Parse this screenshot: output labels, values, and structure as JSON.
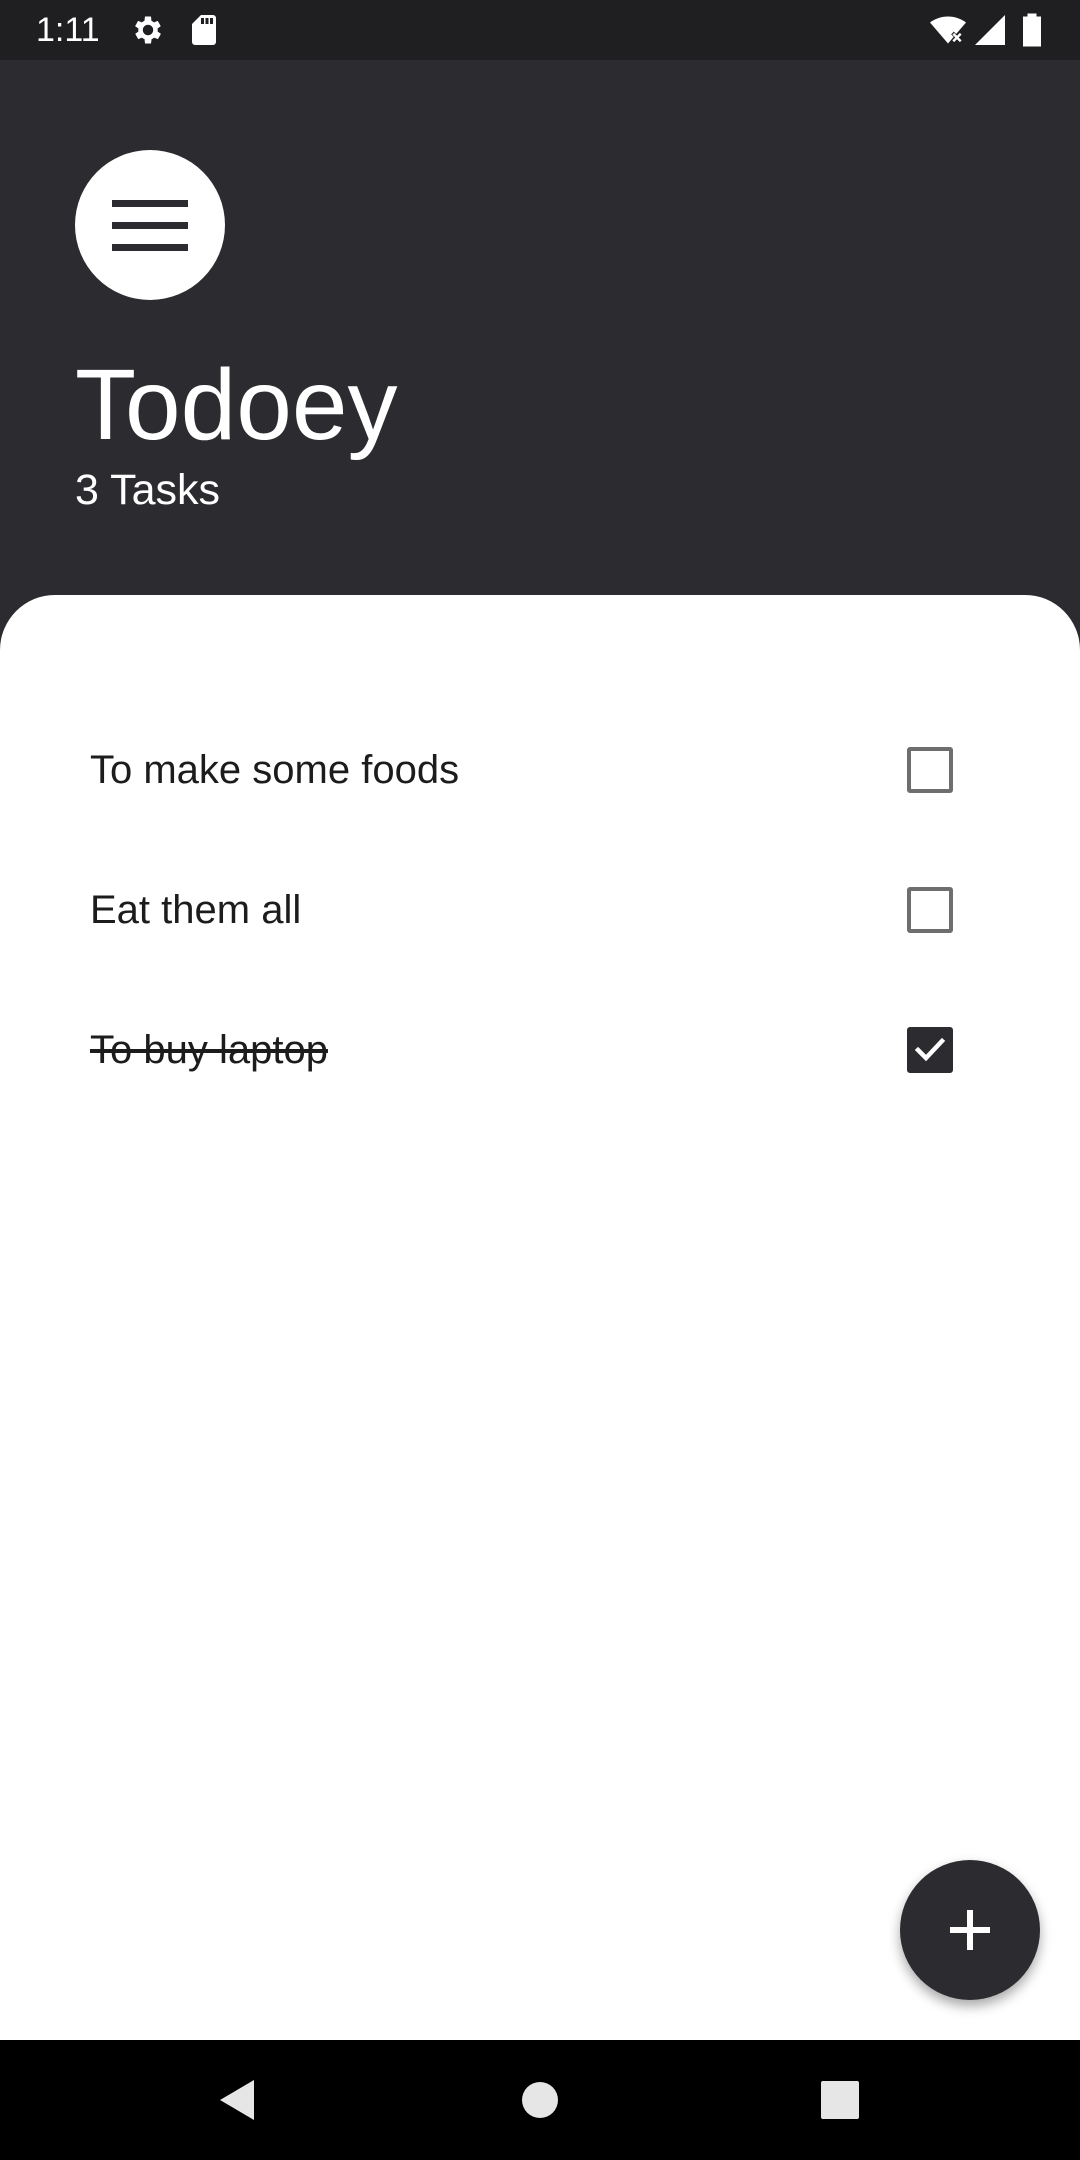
{
  "status_bar": {
    "time": "1:11",
    "icons": [
      "gear-icon",
      "sd-card-icon",
      "wifi-icon",
      "signal-icon",
      "battery-icon"
    ]
  },
  "header": {
    "menu_icon": "hamburger-menu-icon",
    "title": "Todoey",
    "task_count": "3 Tasks"
  },
  "tasks": [
    {
      "label": "To make some foods",
      "done": false
    },
    {
      "label": "Eat them all",
      "done": false
    },
    {
      "label": "To buy laptop",
      "done": true
    }
  ],
  "fab": {
    "icon": "plus-icon"
  },
  "nav_bar": {
    "buttons": [
      "back-icon",
      "home-icon",
      "recents-icon"
    ]
  },
  "colors": {
    "header_bg": "#2b2b30",
    "sheet_bg": "#ffffff",
    "accent": "#2b2b30",
    "text": "#1c1c1c"
  }
}
